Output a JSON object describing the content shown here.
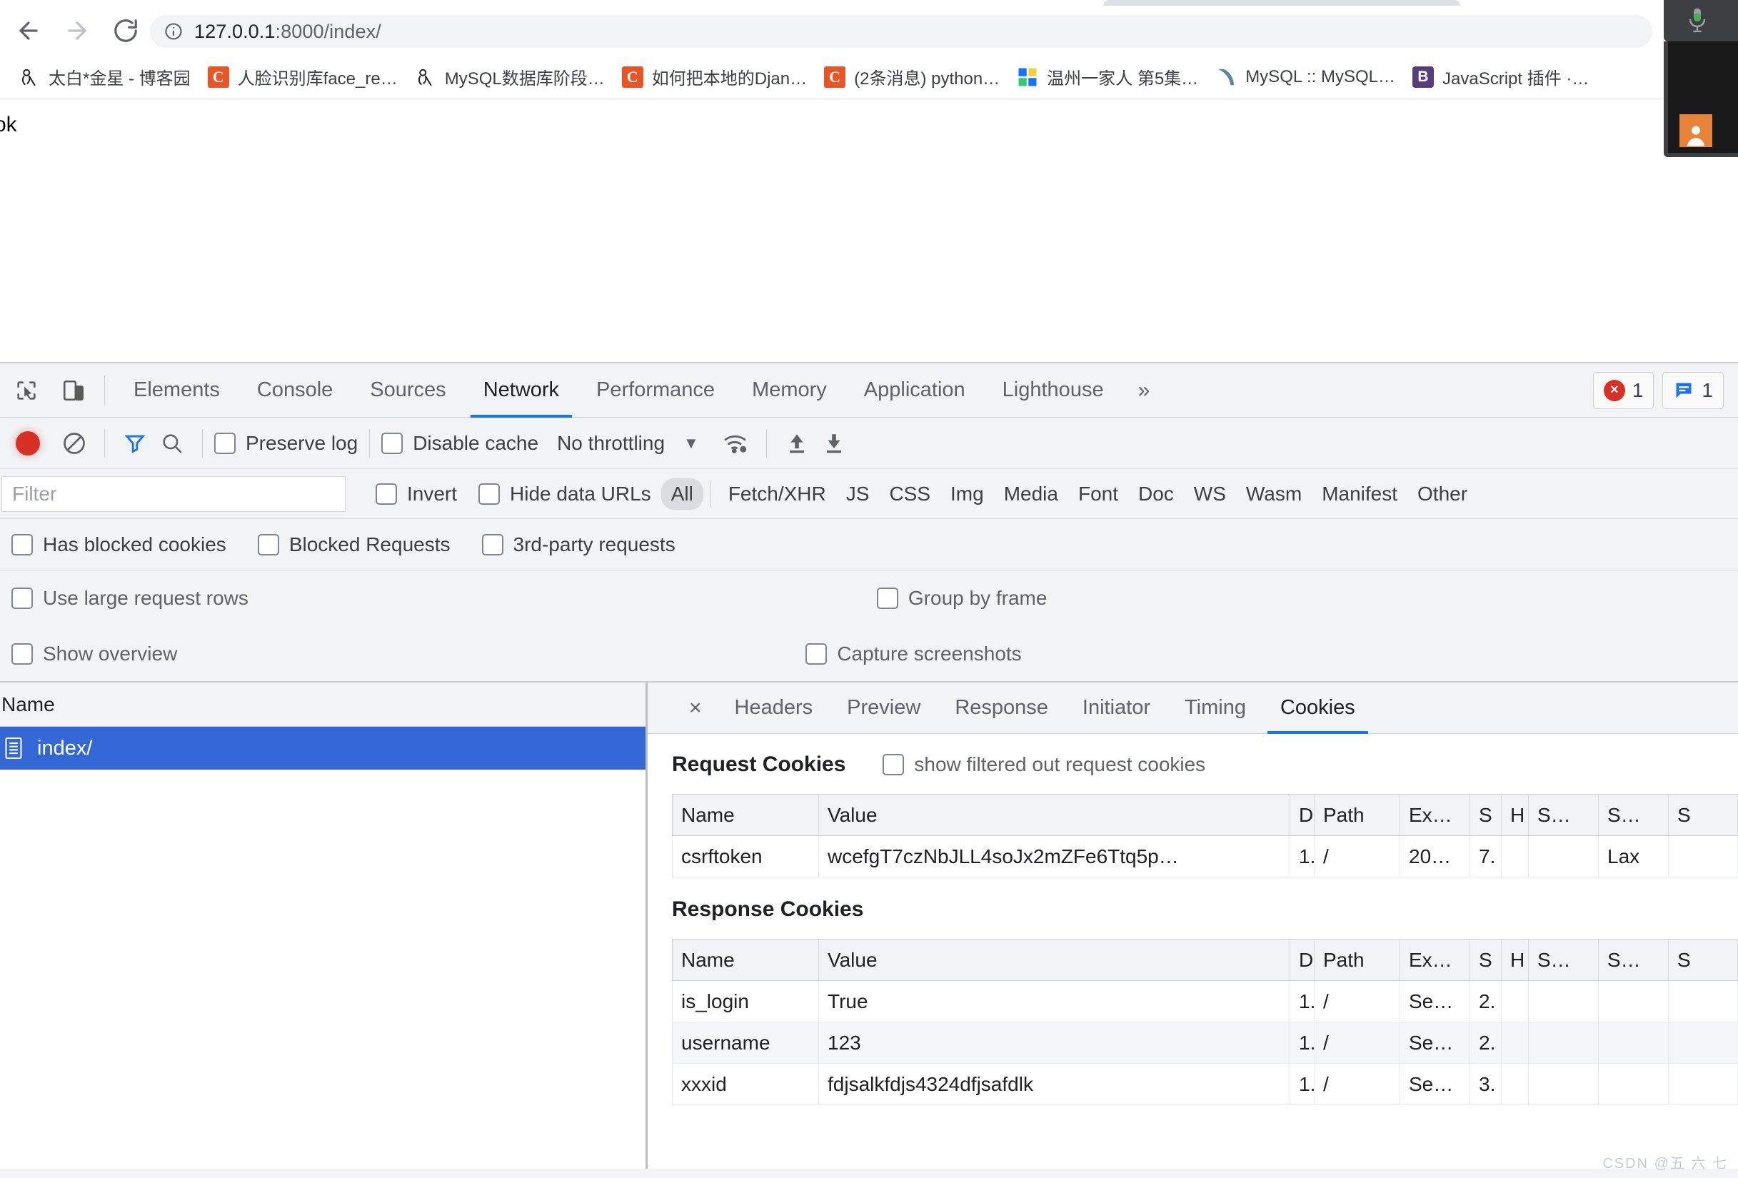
{
  "browser": {
    "back_label": "Back",
    "forward_label": "Forward",
    "reload_label": "Reload",
    "url_host": "127.0.0.1",
    "url_path": ":8000/index/",
    "url_full": "127.0.0.1:8000/index/",
    "bookmarks": [
      {
        "label": "太白*金星 - 博客园",
        "icon": "cnblogs-icon"
      },
      {
        "label": "人脸识别库face_re…",
        "icon": "csdn-icon"
      },
      {
        "label": "MySQL数据库阶段…",
        "icon": "cnblogs-icon"
      },
      {
        "label": "如何把本地的Djan…",
        "icon": "csdn-icon"
      },
      {
        "label": "(2条消息) python…",
        "icon": "csdn-icon"
      },
      {
        "label": "温州一家人 第5集…",
        "icon": "zhihu-icon"
      },
      {
        "label": "MySQL :: MySQL…",
        "icon": "mysql-icon"
      },
      {
        "label": "JavaScript 插件 ·…",
        "icon": "bootstrap-icon"
      }
    ]
  },
  "page": {
    "body_text": "ok"
  },
  "devtools": {
    "panels": [
      {
        "label": "Elements",
        "active": false
      },
      {
        "label": "Console",
        "active": false
      },
      {
        "label": "Sources",
        "active": false
      },
      {
        "label": "Network",
        "active": true
      },
      {
        "label": "Performance",
        "active": false
      },
      {
        "label": "Memory",
        "active": false
      },
      {
        "label": "Application",
        "active": false
      },
      {
        "label": "Lighthouse",
        "active": false
      }
    ],
    "more_panels_label": "»",
    "error_count": "1",
    "message_count": "1",
    "toolbar": {
      "record_label": "Record",
      "clear_label": "Clear",
      "filter_label": "Filter",
      "search_label": "Search",
      "preserve_log": "Preserve log",
      "disable_cache": "Disable cache",
      "throttling_value": "No throttling",
      "import_har_label": "Import HAR",
      "export_har_label": "Export HAR"
    },
    "filterbar": {
      "filter_placeholder": "Filter",
      "invert": "Invert",
      "hide_data_urls": "Hide data URLs",
      "types": [
        {
          "label": "All",
          "active": true
        },
        {
          "label": "Fetch/XHR",
          "active": false
        },
        {
          "label": "JS",
          "active": false
        },
        {
          "label": "CSS",
          "active": false
        },
        {
          "label": "Img",
          "active": false
        },
        {
          "label": "Media",
          "active": false
        },
        {
          "label": "Font",
          "active": false
        },
        {
          "label": "Doc",
          "active": false
        },
        {
          "label": "WS",
          "active": false
        },
        {
          "label": "Wasm",
          "active": false
        },
        {
          "label": "Manifest",
          "active": false
        },
        {
          "label": "Other",
          "active": false
        }
      ]
    },
    "options": {
      "has_blocked_cookies": "Has blocked cookies",
      "blocked_requests": "Blocked Requests",
      "third_party_requests": "3rd-party requests",
      "use_large_request_rows": "Use large request rows",
      "group_by_frame": "Group by frame",
      "show_overview": "Show overview",
      "capture_screenshots": "Capture screenshots"
    },
    "request_list": {
      "column_header": "Name",
      "rows": [
        {
          "name": "index/",
          "selected": true
        }
      ]
    },
    "detail": {
      "close_label": "×",
      "tabs": [
        {
          "label": "Headers",
          "active": false
        },
        {
          "label": "Preview",
          "active": false
        },
        {
          "label": "Response",
          "active": false
        },
        {
          "label": "Initiator",
          "active": false
        },
        {
          "label": "Timing",
          "active": false
        },
        {
          "label": "Cookies",
          "active": true
        }
      ],
      "request_cookies": {
        "title": "Request Cookies",
        "show_filtered_label": "show filtered out request cookies",
        "columns": [
          "Name",
          "Value",
          "D",
          "Path",
          "Ex…",
          "S",
          "H",
          "S…",
          "S…",
          "S"
        ],
        "rows": [
          [
            "csrftoken",
            "wcefgT7czNbJLL4soJx2mZFe6Ttq5p…",
            "1.",
            "/",
            "20…",
            "7.",
            "",
            "",
            "Lax",
            ""
          ]
        ]
      },
      "response_cookies": {
        "title": "Response Cookies",
        "columns": [
          "Name",
          "Value",
          "D",
          "Path",
          "Ex…",
          "S",
          "H",
          "S…",
          "S…",
          "S"
        ],
        "rows": [
          [
            "is_login",
            "True",
            "1.",
            "/",
            "Se…",
            "2.",
            "",
            "",
            "",
            ""
          ],
          [
            "username",
            "123",
            "1.",
            "/",
            "Se…",
            "2.",
            "",
            "",
            "",
            ""
          ],
          [
            "xxxid",
            "fdjsalkfdjs4324dfjsafdlk",
            "1.",
            "/",
            "Se…",
            "3.",
            "",
            "",
            "",
            ""
          ]
        ]
      }
    }
  },
  "overlay": {
    "mic_label": "Microphone",
    "avatar_label": "User avatar"
  },
  "watermark": {
    "text": "CSDN @五 六 七"
  },
  "colors": {
    "accent": "#1a73e8",
    "selection": "#3367d6",
    "error": "#d93025",
    "chrome_bg": "#f1f3f4",
    "avatar": "#e8833a"
  }
}
